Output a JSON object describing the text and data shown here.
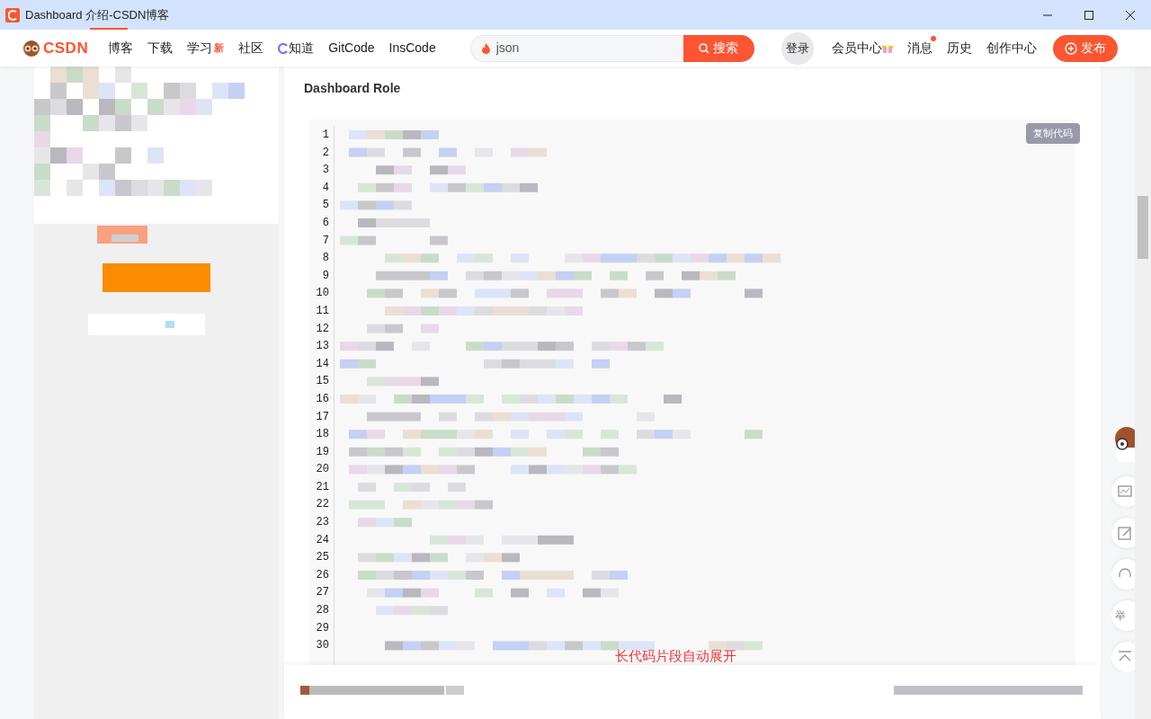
{
  "window": {
    "title": "Dashboard 介绍-CSDN博客"
  },
  "nav": {
    "logo": "CSDN",
    "links": [
      {
        "label": "博客",
        "kind": "plain"
      },
      {
        "label": "下载",
        "kind": "plain"
      },
      {
        "label": "学习",
        "kind": "new",
        "badge": "新"
      },
      {
        "label": "社区",
        "kind": "plain"
      },
      {
        "label": "知道",
        "kind": "zhidao"
      },
      {
        "label": "GitCode",
        "kind": "plain"
      },
      {
        "label": "InsCode",
        "kind": "plain"
      }
    ],
    "search": {
      "value": "json",
      "button": "搜索"
    },
    "login": "登录",
    "right_links": [
      {
        "label": "会员中心",
        "kind": "gift",
        "dot": false
      },
      {
        "label": "消息",
        "kind": "plain",
        "dot": true
      },
      {
        "label": "历史",
        "kind": "plain",
        "dot": false
      },
      {
        "label": "创作中心",
        "kind": "plain",
        "dot": false
      }
    ],
    "publish": "发布"
  },
  "article": {
    "heading": "Dashboard Role",
    "code": {
      "copy_button": "复制代码",
      "line_numbers": [
        "1",
        "2",
        "3",
        "4",
        "5",
        "6",
        "7",
        "8",
        "9",
        "10",
        "11",
        "12",
        "13",
        "14",
        "15",
        "16",
        "17",
        "18",
        "19",
        "20",
        "21",
        "22",
        "23",
        "24",
        "25",
        "26",
        "27",
        "28",
        "29",
        "30"
      ],
      "expand_note": "长代码片段自动展开"
    }
  },
  "side_tools": [
    {
      "kind": "chart"
    },
    {
      "kind": "edit"
    },
    {
      "kind": "headset"
    },
    {
      "kind": "text",
      "label": "举"
    },
    {
      "kind": "top"
    }
  ]
}
